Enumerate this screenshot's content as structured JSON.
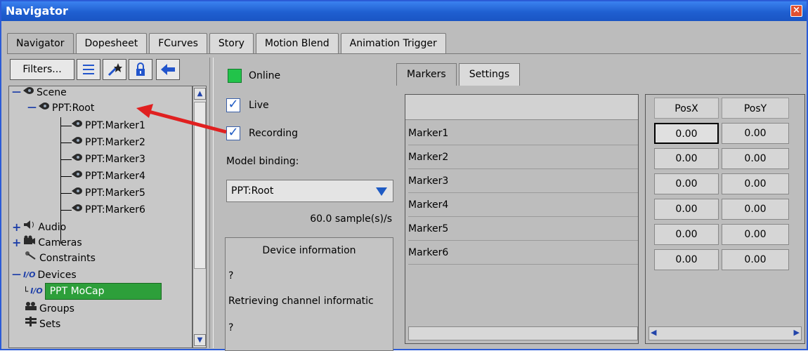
{
  "window": {
    "title": "Navigator",
    "close": "×"
  },
  "tabs": [
    "Navigator",
    "Dopesheet",
    "FCurves",
    "Story",
    "Motion Blend",
    "Animation Trigger"
  ],
  "toolbar": {
    "filters_label": "Filters..."
  },
  "tree": {
    "scene": "Scene",
    "root": "PPT:Root",
    "markers": [
      "PPT:Marker1",
      "PPT:Marker2",
      "PPT:Marker3",
      "PPT:Marker4",
      "PPT:Marker5",
      "PPT:Marker6"
    ],
    "audio": "Audio",
    "cameras": "Cameras",
    "constraints": "Constraints",
    "devices": "Devices",
    "device_item": "PPT MoCap",
    "groups": "Groups",
    "sets": "Sets"
  },
  "settings": {
    "online": "Online",
    "live": "Live",
    "recording": "Recording",
    "model_binding_label": "Model binding:",
    "model_binding_value": "PPT:Root",
    "sample_rate": "60.0 sample(s)/s",
    "device_info_title": "Device information",
    "device_info_line1": "?",
    "device_info_line2": "Retrieving channel informatic",
    "device_info_line3": "?"
  },
  "subtabs": [
    "Markers",
    "Settings"
  ],
  "markers_table": {
    "rows": [
      "Marker1",
      "Marker2",
      "Marker3",
      "Marker4",
      "Marker5",
      "Marker6"
    ],
    "columns": [
      "PosX",
      "PosY"
    ],
    "values": [
      [
        "0.00",
        "0.00"
      ],
      [
        "0.00",
        "0.00"
      ],
      [
        "0.00",
        "0.00"
      ],
      [
        "0.00",
        "0.00"
      ],
      [
        "0.00",
        "0.00"
      ],
      [
        "0.00",
        "0.00"
      ]
    ]
  },
  "colors": {
    "online": "#22c34a",
    "selected_device": "#2d9f3a",
    "annotation_arrow": "#e02020"
  }
}
